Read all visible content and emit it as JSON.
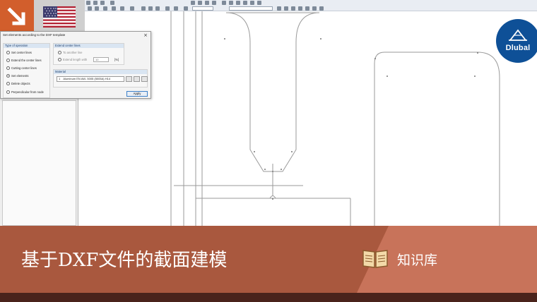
{
  "dialog": {
    "title": "Set elements according to the DXF template",
    "close_glyph": "×",
    "type_group": {
      "heading": "Type of operation",
      "options": [
        {
          "label": "Set center lines",
          "selected": false
        },
        {
          "label": "Extend the center lines",
          "selected": false
        },
        {
          "label": "Cutting center lines",
          "selected": false
        },
        {
          "label": "Set elements",
          "selected": true
        },
        {
          "label": "Delete objects",
          "selected": false
        },
        {
          "label": "Perpendicular from node",
          "selected": false
        }
      ]
    },
    "extend_group": {
      "heading": "Extend center lines",
      "to_another_line": "To another line",
      "extend_length_with": "Extend length with",
      "length_value": "10",
      "unit": "[%]"
    },
    "material_group": {
      "heading": "Material",
      "number": "1",
      "selected": "Aluminum EN AW- 5005 (5005A) H14"
    },
    "apply_label": "Apply"
  },
  "logo": {
    "text": "Dlubal",
    "color": "#0e5097"
  },
  "banner": {
    "title": "基于DXF文件的截面建模",
    "knowledge_label": "知识库",
    "dark_color": "#a9583e",
    "light_color": "#c8735a"
  },
  "icons": {
    "corner_arrow": "arrow-down-right-icon",
    "flag": "us-flag-icon",
    "knowledge": "book-icon"
  }
}
